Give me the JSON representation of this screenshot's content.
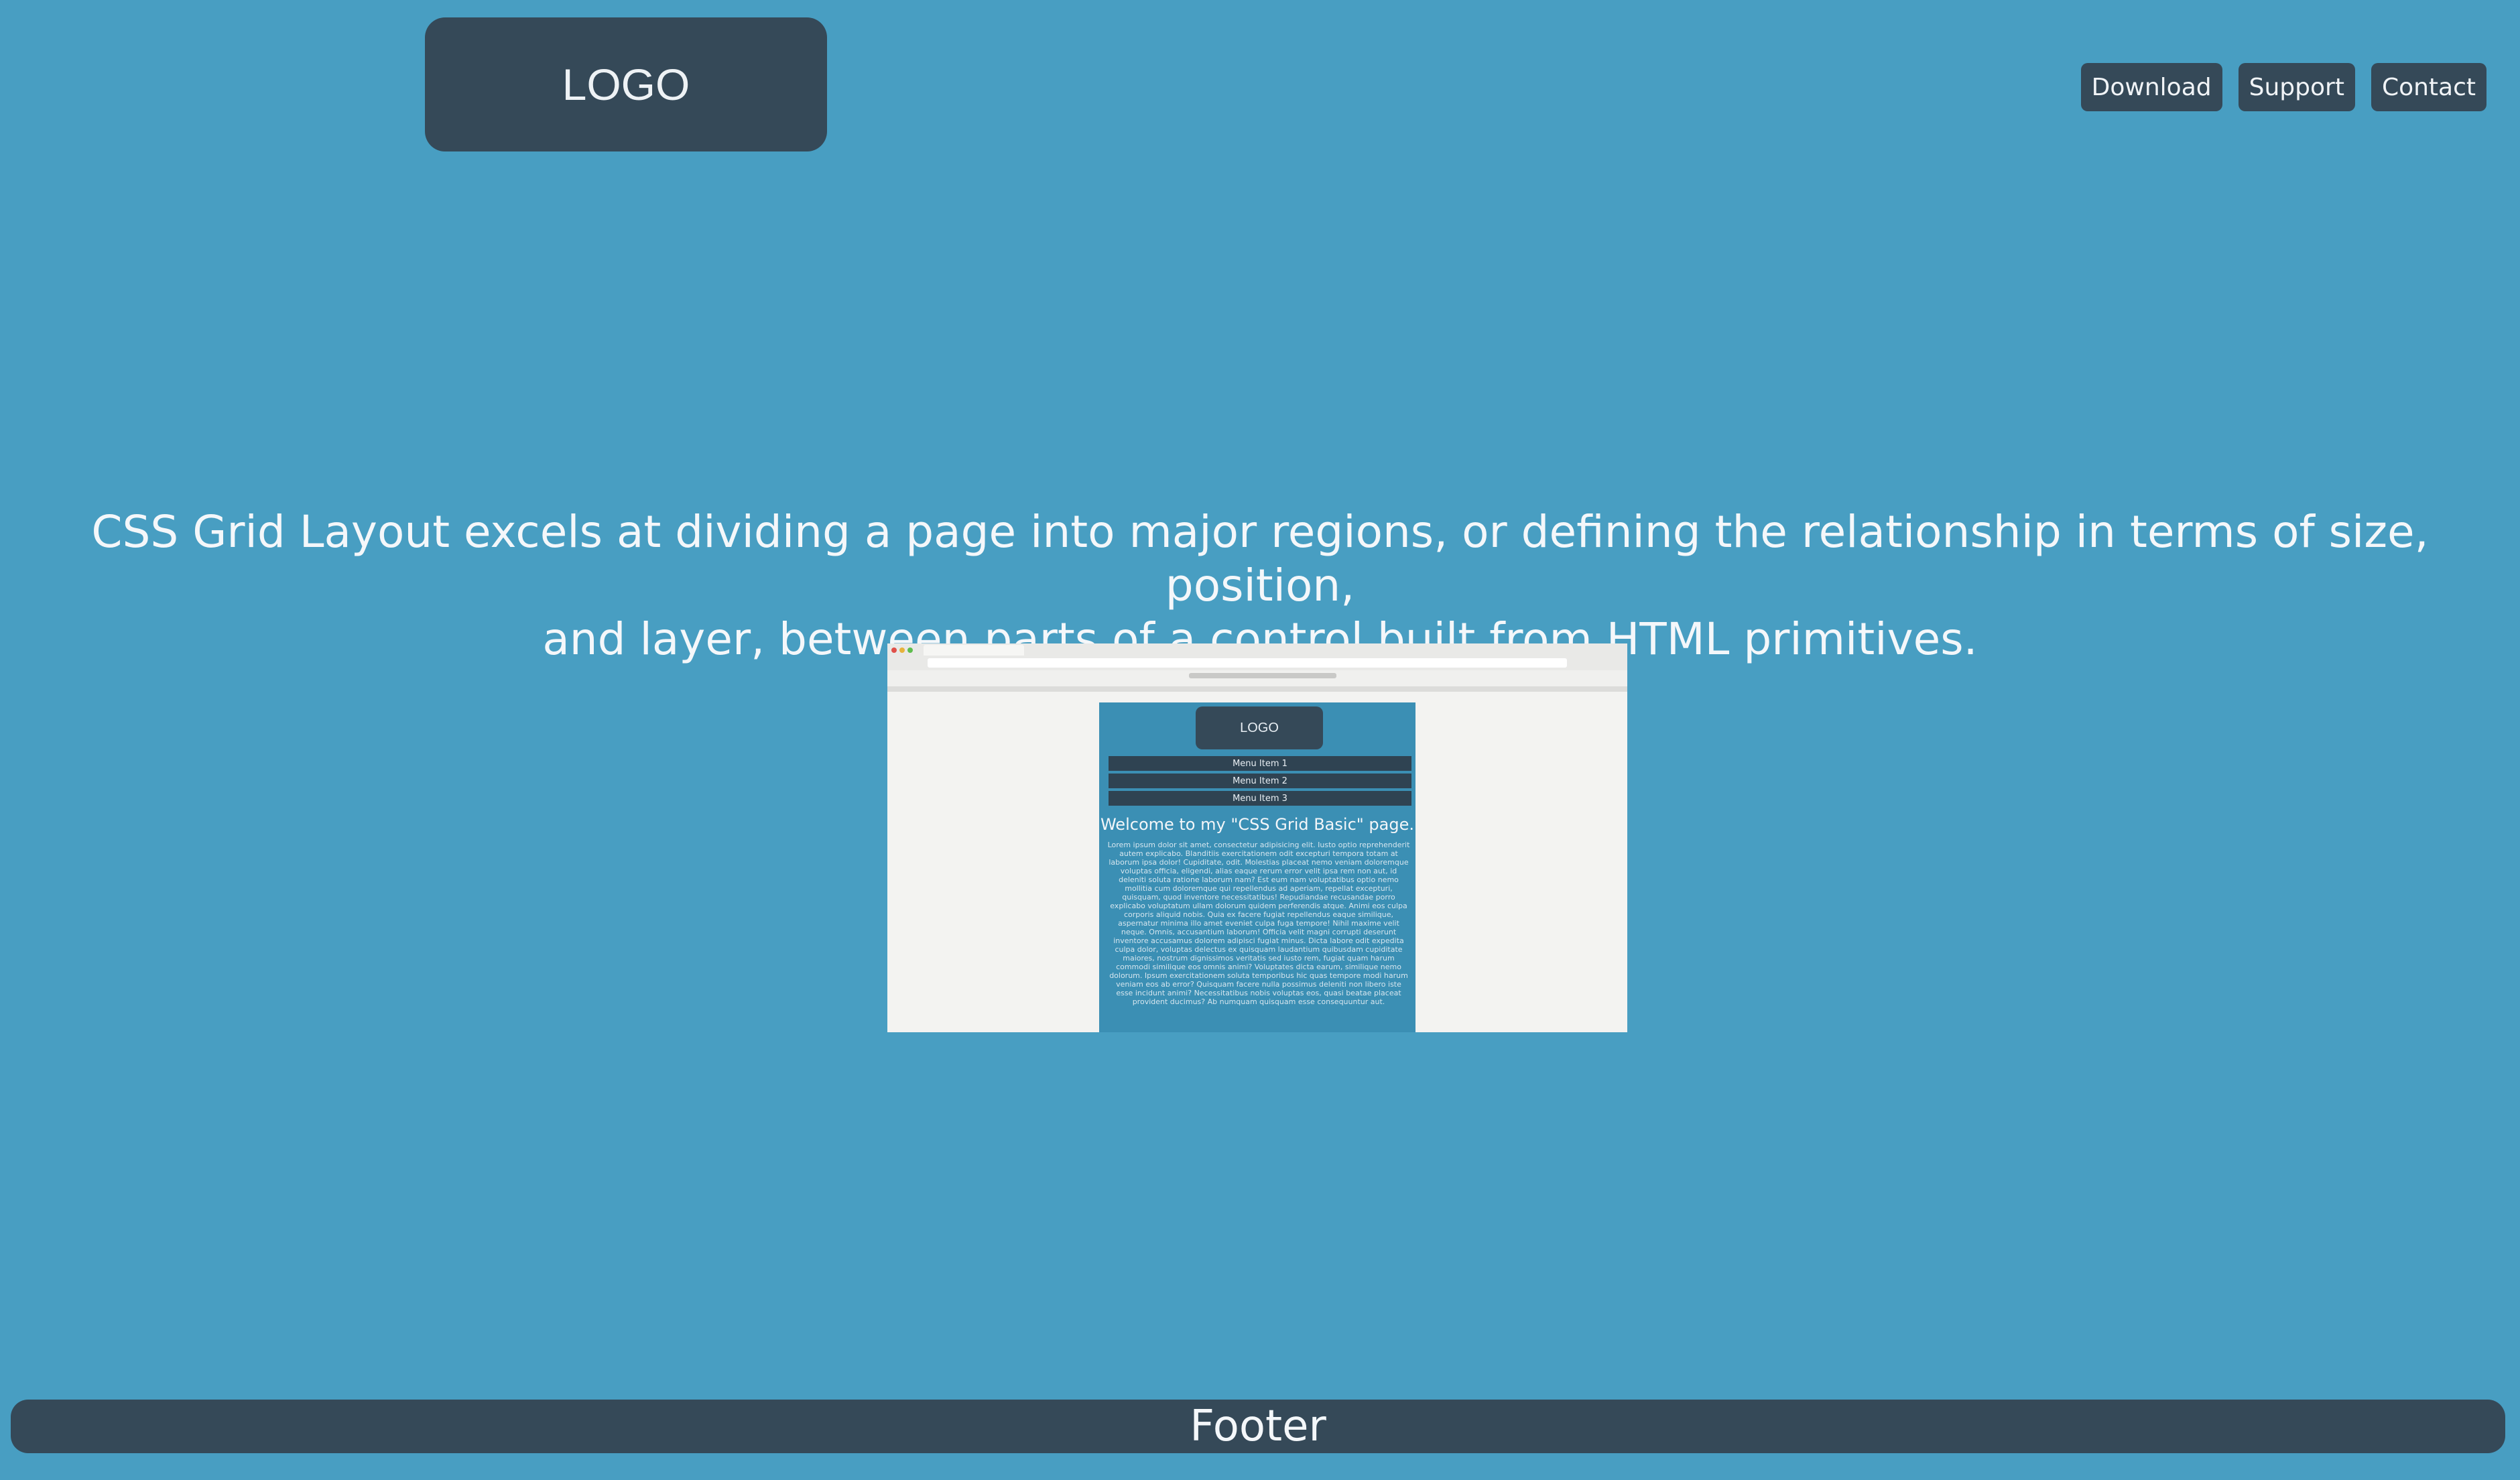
{
  "header": {
    "logo_text": "LOGO",
    "nav": [
      {
        "label": "Download"
      },
      {
        "label": "Support"
      },
      {
        "label": "Contact"
      }
    ]
  },
  "hero": {
    "line1": "CSS Grid Layout excels at dividing a page into major regions, or defining the relationship in terms of size, position,",
    "line2": "and layer, between parts of a control built from HTML primitives."
  },
  "screenshot": {
    "logo_text": "LOGO",
    "menu": [
      "Menu Item 1",
      "Menu Item 2",
      "Menu Item 3"
    ],
    "title": "Welcome to my \"CSS Grid Basic\" page.",
    "body": "Lorem ipsum dolor sit amet, consectetur adipisicing elit. Iusto optio reprehenderit autem explicabo. Blanditiis exercitationem odit excepturi tempora totam at laborum ipsa dolor! Cupiditate, odit. Molestias placeat nemo veniam doloremque voluptas officia, eligendi, alias eaque rerum error velit ipsa rem non aut, id deleniti soluta ratione laborum nam? Est eum nam voluptatibus optio nemo mollitia cum doloremque qui repellendus ad aperiam, repellat excepturi, quisquam, quod inventore necessitatibus! Repudiandae recusandae porro explicabo voluptatum ullam dolorum quidem perferendis atque. Animi eos culpa corporis aliquid nobis. Quia ex facere fugiat repellendus eaque similique, aspernatur minima illo amet eveniet culpa fuga tempore! Nihil maxime velit neque. Omnis, accusantium laborum! Officia velit magni corrupti deserunt inventore accusamus dolorem adipisci fugiat minus. Dicta labore odit expedita culpa dolor, voluptas delectus ex quisquam laudantium quibusdam cupiditate maiores, nostrum dignissimos veritatis sed iusto rem, fugiat quam harum commodi similique eos omnis animi? Voluptates dicta earum, similique nemo dolorum. Ipsum exercitationem soluta temporibus hic quas tempore modi harum veniam eos ab error? Quisquam facere nulla possimus deleniti non libero iste esse incidunt animi? Necessitatibus nobis voluptas eos, quasi beatae placeat provident ducimus? Ab numquam quisquam esse consequuntur aut."
  },
  "footer": {
    "text": "Footer"
  },
  "colors": {
    "background": "#489ec2",
    "panel": "#354958",
    "text": "#f4f7fa"
  }
}
